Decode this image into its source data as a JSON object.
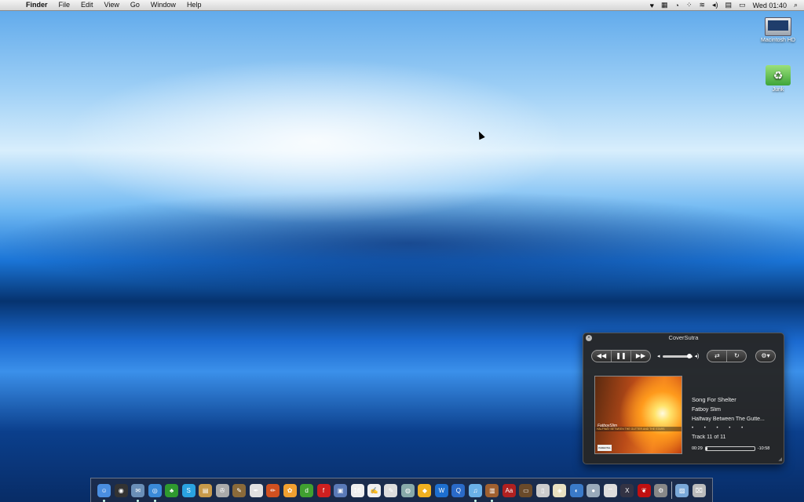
{
  "menubar": {
    "app": "Finder",
    "menus": [
      "File",
      "Edit",
      "View",
      "Go",
      "Window",
      "Help"
    ],
    "clock": "Wed 01:40"
  },
  "desktop_icons": [
    {
      "label": "Macintosh HD"
    },
    {
      "label": "Junk"
    }
  ],
  "player": {
    "title": "CoverSutra",
    "song": "Song For Shelter",
    "artist": "Fatboy Slim",
    "album": "Halfway Between The Gutte...",
    "rating_dots": "• • • • •",
    "track": "Track 11 of 11",
    "elapsed": "00:29",
    "remaining": "-10:58",
    "progress": 0.04,
    "volume": 0.9,
    "cover_band_text": "HALFWAY BETWEEN THE GUTTER AND THE STARS",
    "cover_logo": "FatboySlim",
    "advisory": "PARENTAL ADVISORY"
  },
  "dock": {
    "items": [
      {
        "icon": "finder-icon",
        "bg": "#4a8ee0",
        "glyph": "☺",
        "run": true
      },
      {
        "icon": "dashboard-icon",
        "bg": "#333",
        "glyph": "◉",
        "run": false
      },
      {
        "icon": "mail-icon",
        "bg": "#6a8fb8",
        "glyph": "✉",
        "run": true
      },
      {
        "icon": "safari-icon",
        "bg": "#3a8ad8",
        "glyph": "◎",
        "run": true
      },
      {
        "icon": "adium-icon",
        "bg": "#2f9a2f",
        "glyph": "♣",
        "run": false
      },
      {
        "icon": "skype-icon",
        "bg": "#2aa3e0",
        "glyph": "S",
        "run": false
      },
      {
        "icon": "notebook-icon",
        "bg": "#c89a4a",
        "glyph": "▤",
        "run": false
      },
      {
        "icon": "disk-utility-icon",
        "bg": "#aaa",
        "glyph": "✇",
        "run": false
      },
      {
        "icon": "paint-icon",
        "bg": "#8a6a3a",
        "glyph": "✎",
        "run": false
      },
      {
        "icon": "feather-icon",
        "bg": "#e0e0e0",
        "glyph": "✒",
        "run": false
      },
      {
        "icon": "pencil-icon",
        "bg": "#d05020",
        "glyph": "✏",
        "run": false
      },
      {
        "icon": "photo-icon",
        "bg": "#f0a030",
        "glyph": "✿",
        "run": false
      },
      {
        "icon": "dreamweaver-icon",
        "bg": "#40a030",
        "glyph": "d",
        "run": false
      },
      {
        "icon": "flash-icon",
        "bg": "#d02020",
        "glyph": "f",
        "run": false
      },
      {
        "icon": "preview-icon",
        "bg": "#5a7ab8",
        "glyph": "▣",
        "run": false
      },
      {
        "icon": "calendar-icon",
        "bg": "#eee",
        "glyph": "16",
        "run": false
      },
      {
        "icon": "textedit-icon",
        "bg": "#f0f0f0",
        "glyph": "✍",
        "run": false
      },
      {
        "icon": "script-icon",
        "bg": "#ddd",
        "glyph": "✎",
        "run": false
      },
      {
        "icon": "iphoto-icon",
        "bg": "#8aa",
        "glyph": "◍",
        "run": false
      },
      {
        "icon": "warning-icon",
        "bg": "#f0b020",
        "glyph": "◆",
        "run": false
      },
      {
        "icon": "w-icon",
        "bg": "#1d6fd0",
        "glyph": "W",
        "run": false
      },
      {
        "icon": "quicktime-icon",
        "bg": "#2a6ac8",
        "glyph": "Q",
        "run": false
      },
      {
        "icon": "itunes-icon",
        "bg": "#6ab0e8",
        "glyph": "♫",
        "run": true
      },
      {
        "icon": "books-icon",
        "bg": "#a06030",
        "glyph": "▥",
        "run": true
      },
      {
        "icon": "dictionary-icon",
        "bg": "#b02020",
        "glyph": "Aa",
        "run": false
      },
      {
        "icon": "frontrow-icon",
        "bg": "#6a4a2a",
        "glyph": "▭",
        "run": false
      },
      {
        "icon": "remote-icon",
        "bg": "#ccc",
        "glyph": "▯",
        "run": false
      },
      {
        "icon": "package-icon",
        "bg": "#e8e0c0",
        "glyph": "◈",
        "run": false
      },
      {
        "icon": "globe-icon",
        "bg": "#3a7ac8",
        "glyph": "◐",
        "run": false
      },
      {
        "icon": "sphere-icon",
        "bg": "#9ab",
        "glyph": "●",
        "run": false
      },
      {
        "icon": "wifi-icon",
        "bg": "#ddd",
        "glyph": "⌔",
        "run": false
      },
      {
        "icon": "x11-icon",
        "bg": "#334",
        "glyph": "X",
        "run": false
      },
      {
        "icon": "bug-icon",
        "bg": "#c01010",
        "glyph": "❦",
        "run": false
      },
      {
        "icon": "system-preferences-icon",
        "bg": "#888",
        "glyph": "⚙",
        "run": false
      },
      {
        "icon": "applications-folder-icon",
        "bg": "#7aa8d8",
        "glyph": "▨",
        "run": false
      },
      {
        "icon": "trash-icon",
        "bg": "#bbb",
        "glyph": "⌧",
        "run": false
      }
    ]
  }
}
